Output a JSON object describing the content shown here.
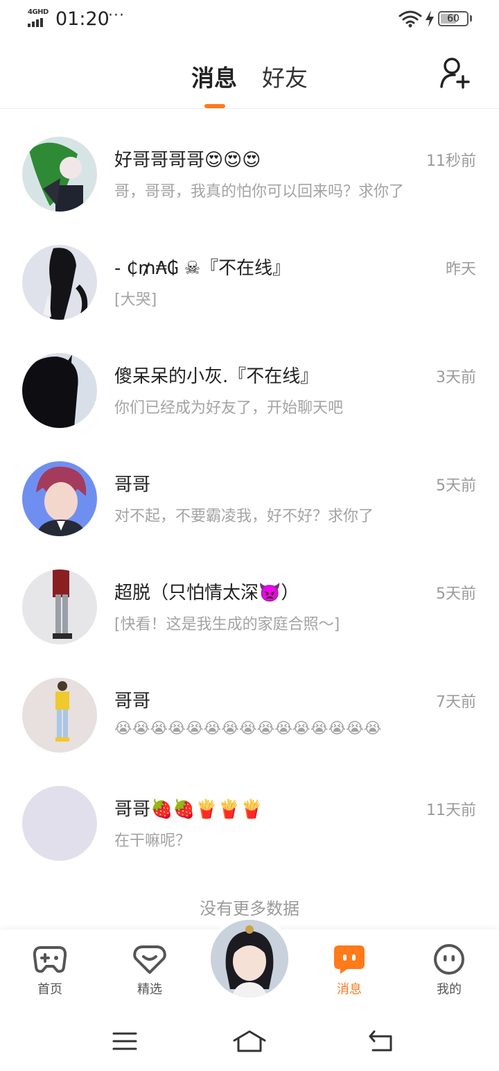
{
  "status_bar": {
    "network": "4GHD",
    "time": "01:20",
    "dots": "···",
    "battery": "60",
    "battery_level": 0.6
  },
  "header": {
    "tabs": [
      {
        "label": "消息",
        "active": true
      },
      {
        "label": "好友",
        "active": false
      }
    ],
    "accent_color": "#ff7a1a",
    "add_friend_icon": "add-user-icon"
  },
  "conversations": [
    {
      "name": "好哥哥哥哥😍😍😍",
      "time": "11秒前",
      "preview": "哥，哥哥，我真的怕你可以回来吗？求你了",
      "avatar_bg": "#d7e4e6"
    },
    {
      "name": "- ₵₥₳₲ ☠『不在线』",
      "time": "昨天",
      "preview": "[大哭]",
      "avatar_bg": "#dfe2ea"
    },
    {
      "name": "傻呆呆的小灰.『不在线』",
      "time": "3天前",
      "preview": "你们已经成为好友了，开始聊天吧",
      "avatar_bg": "#d9dfe8"
    },
    {
      "name": "哥哥",
      "time": "5天前",
      "preview": "对不起，不要霸凌我，好不好？求你了",
      "avatar_bg": "#6f8ff0"
    },
    {
      "name": "超脱（只怕情太深👿）",
      "time": "5天前",
      "preview": "[快看！这是我生成的家庭合照～]",
      "avatar_bg": "#e6e6e8"
    },
    {
      "name": "哥哥",
      "time": "7天前",
      "preview": "😭😭😭😭😭😭😭😭😭😭😭😭😭😭😭",
      "avatar_bg": "#e8dfdf"
    },
    {
      "name": "哥哥🍓🍓🍟🍟🍟",
      "time": "11天前",
      "preview": "在干嘛呢？",
      "avatar_bg": "#e2dfec"
    }
  ],
  "footer_text": "没有更多数据",
  "bottom_nav": {
    "items": [
      {
        "label": "首页",
        "icon": "gamepad-icon"
      },
      {
        "label": "精选",
        "icon": "heart-smile-icon"
      },
      {
        "label": "消息",
        "icon": "message-bubble-icon",
        "active": true
      },
      {
        "label": "我的",
        "icon": "face-icon"
      }
    ],
    "center_icon": "avatar-create-icon"
  },
  "system_nav": {
    "icons": [
      "menu-icon",
      "home-icon",
      "back-icon"
    ]
  }
}
